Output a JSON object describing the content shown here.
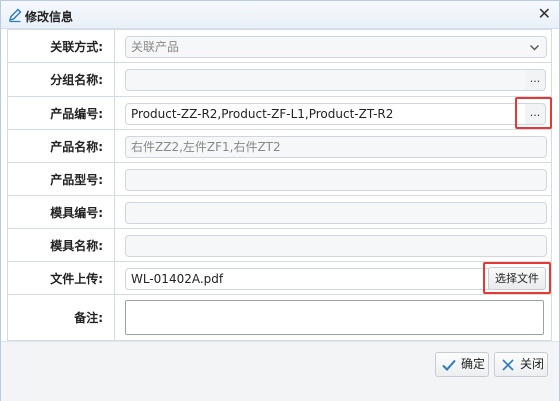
{
  "dialog": {
    "title": "修改信息",
    "close_glyph": "✕",
    "title_icon": "edit-pencil-icon"
  },
  "form": {
    "association": {
      "label": "关联方式:",
      "value": "关联产品"
    },
    "group_name": {
      "label": "分组名称:",
      "value": "",
      "button": "..."
    },
    "product_code": {
      "label": "产品编号:",
      "value": "Product-ZZ-R2,Product-ZF-L1,Product-ZT-R2",
      "button": "..."
    },
    "product_name": {
      "label": "产品名称:",
      "value": "右件ZZ2,左件ZF1,右件ZT2"
    },
    "product_model": {
      "label": "产品型号:",
      "value": ""
    },
    "mold_code": {
      "label": "模具编号:",
      "value": ""
    },
    "mold_name": {
      "label": "模具名称:",
      "value": ""
    },
    "file_upload": {
      "label": "文件上传:",
      "value": "WL-01402A.pdf",
      "button": "选择文件"
    },
    "remarks": {
      "label": "备注:",
      "value": ""
    }
  },
  "footer": {
    "ok_label": "确定",
    "cancel_label": "关闭"
  },
  "colors": {
    "highlight": "#e53935",
    "ok_check": "#2a79c8",
    "cancel_x": "#2a79c8"
  }
}
